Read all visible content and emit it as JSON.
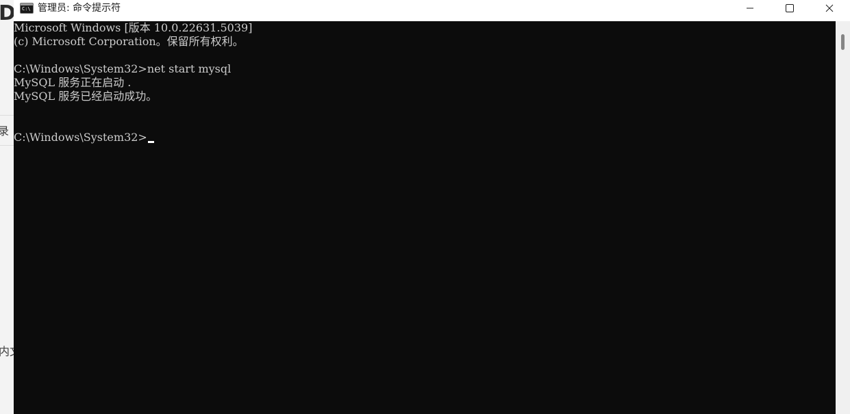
{
  "background_app": {
    "fragments": [
      "D",
      "录",
      "内文"
    ]
  },
  "window": {
    "title": "管理员: 命令提示符",
    "icon": "cmd-icon",
    "controls": {
      "minimize_icon": "minimize-icon",
      "maximize_icon": "maximize-icon",
      "close_icon": "close-icon"
    }
  },
  "console": {
    "lines": [
      "Microsoft Windows [版本 10.0.22631.5039]",
      "(c) Microsoft Corporation。保留所有权利。",
      "",
      "C:\\Windows\\System32>net start mysql",
      "MySQL 服务正在启动 .",
      "MySQL 服务已经启动成功。",
      "",
      "",
      "C:\\Windows\\System32>"
    ],
    "text_color": "#cccccc",
    "background_color": "#0c0c0c"
  }
}
